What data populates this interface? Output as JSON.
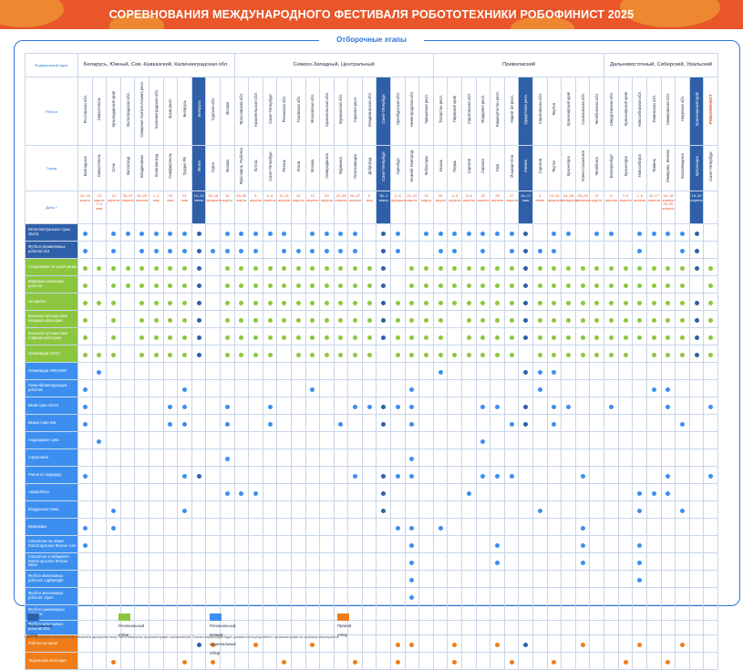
{
  "title": "СОРЕВНОВАНИЯ МЕЖДУНАРОДНОГО ФЕСТИВАЛЯ РОБОТОТЕХНИКИ РОБОФИНИСТ 2025",
  "section_label": "Отборочные этапы",
  "row_labels": {
    "district": "Федеральный округ",
    "region": "Регион",
    "city": "Город",
    "date": "Даты *"
  },
  "logo_text": "РОБОФИНИСТ",
  "colors": {
    "dark": "#2f5fa8",
    "blue": "#3c8ff0",
    "green": "#8cc63f",
    "orange": "#f07d1a",
    "banner": "#e8562a"
  },
  "districts": [
    {
      "name": "Беларусь, Южный, Сев.-Кавказский, Калининградская обл.",
      "span": 11
    },
    {
      "name": "Северо-Западный, Центральный",
      "span": 14
    },
    {
      "name": "Приволжский",
      "span": 12
    },
    {
      "name": "Дальневосточный, Сибирский, Уральский",
      "span": 10
    }
  ],
  "stages": [
    {
      "region": "Ростовская обл.",
      "city": "Волгодонск",
      "date": "14–16\nмарта",
      "hl": false
    },
    {
      "region": "Севастополь",
      "city": "Севастополь",
      "date": "15\nмарта\n2–5\nмая",
      "hl": false
    },
    {
      "region": "Краснодарский край",
      "city": "Сочи",
      "date": "13\nапреля",
      "hl": false
    },
    {
      "region": "Волгоградская обл.",
      "city": "Волгоград",
      "date": "26–27\nапреля",
      "hl": false
    },
    {
      "region": "Северная Осетия-Алания респ.",
      "city": "Владикавказ",
      "date": "26–29\nапреля",
      "hl": false
    },
    {
      "region": "Калининградская обл.",
      "city": "Калининград",
      "date": "1–2\nмая",
      "hl": false
    },
    {
      "region": "Крым респ.",
      "city": "Симферополь",
      "date": "16\nмая",
      "hl": false
    },
    {
      "region": "Беларусь",
      "city": "Гродно РБ",
      "date": "31\nмая",
      "hl": false
    },
    {
      "region": "Беларусь",
      "city": "Минск",
      "date": "12–14\nиюня",
      "hl": true
    },
    {
      "region": "Курская обл.",
      "city": "Курск",
      "date": "15–16\nфевраля",
      "hl": false
    },
    {
      "region": "Москва",
      "city": "Москва",
      "date": "15\nмарта",
      "hl": false
    },
    {
      "region": "Ярославская обл.",
      "city": "Ярославль, Рыбинск",
      "date": "29–30\nмарта",
      "hl": false
    },
    {
      "region": "Архангельская обл.",
      "city": "Котлас",
      "date": "5\nапреля",
      "hl": false
    },
    {
      "region": "Санкт-Петербург",
      "city": "Санкт-Петербург",
      "date": "5–6\nапреля",
      "hl": false
    },
    {
      "region": "Рязанская обл.",
      "city": "Рязань",
      "date": "10–11\nапреля",
      "hl": false
    },
    {
      "region": "Псковская обл.",
      "city": "Псков",
      "date": "12\nапреля",
      "hl": false
    },
    {
      "region": "Московская обл.",
      "city": "Москва",
      "date": "12\nапреля",
      "hl": false
    },
    {
      "region": "Архангельская обл.",
      "city": "Северодвинск",
      "date": "20\nапреля",
      "hl": false
    },
    {
      "region": "Мурманская обл.",
      "city": "Мурманск",
      "date": "25–28\nапреля",
      "hl": false
    },
    {
      "region": "Карелия респ.",
      "city": "Петрозаводск",
      "date": "26–27\nапреля",
      "hl": false
    },
    {
      "region": "Владимирская обл.",
      "city": "Добрград",
      "date": "6\nмая",
      "hl": false
    },
    {
      "region": "Санкт-Петербург",
      "city": "Санкт-Петербург",
      "date": "30–1\nиюня",
      "hl": true
    },
    {
      "region": "Оренбургская обл.",
      "city": "Оренбург",
      "date": "2–5\nфевраля",
      "hl": false
    },
    {
      "region": "Нижегородская обл.",
      "city": "Нижний Новгород",
      "date": "21–22\nмарта",
      "hl": false
    },
    {
      "region": "Чувашская респ.",
      "city": "Чебоксары",
      "date": "23\nмарта",
      "hl": false
    },
    {
      "region": "Татарстан респ.",
      "city": "Казань",
      "date": "30\nмарта",
      "hl": false
    },
    {
      "region": "Пермский край",
      "city": "Пермь",
      "date": "4–5\nапреля",
      "hl": false
    },
    {
      "region": "Саратовская обл.",
      "city": "Саратов",
      "date": "5–6\nапреля",
      "hl": false
    },
    {
      "region": "Мордовия респ.",
      "city": "Саранск",
      "date": "22\nапреля",
      "hl": false
    },
    {
      "region": "Башкортостан респ.",
      "city": "Уфа",
      "date": "25\nапреля",
      "hl": false
    },
    {
      "region": "Марий Эл респ.",
      "city": "Йошкар-Ола",
      "date": "27\nапреля",
      "hl": false
    },
    {
      "region": "Удмуртская респ.",
      "city": "Ижевск",
      "date": "16–17\nмая",
      "hl": true
    },
    {
      "region": "Саратовская обл.",
      "city": "Саратов",
      "date": "2\nиюня",
      "hl": false
    },
    {
      "region": "Якутия",
      "city": "Якутск",
      "date": "14–15\nфевраля",
      "hl": false
    },
    {
      "region": "Красноярский край",
      "city": "Красноярск",
      "date": "24–28\nфевраля",
      "hl": false
    },
    {
      "region": "Сахалинская обл.",
      "city": "Южно-Сахалинск",
      "date": "25–26\nфевраля",
      "hl": false
    },
    {
      "region": "Челябинская обл.",
      "city": "Челябинск",
      "date": "27\nмарта",
      "hl": false
    },
    {
      "region": "Свердловская обл.",
      "city": "Екатеринбург",
      "date": "6\nапреля",
      "hl": false
    },
    {
      "region": "Красноярский край",
      "city": "Красноярск",
      "date": "7–9\nапреля",
      "hl": false
    },
    {
      "region": "Новосибирская обл.",
      "city": "Новосибирск",
      "date": "7–9\nапреля",
      "hl": false
    },
    {
      "region": "Тюменская обл.",
      "city": "Тюмень",
      "date": "16–17\nапреля",
      "hl": false
    },
    {
      "region": "Кемеровская обл.",
      "city": "Кемерово, Белово",
      "date": "18–19\nапреля\n25–26\nапреля",
      "hl": false
    },
    {
      "region": "Амурская обл.",
      "city": "Благовещенск",
      "date": "",
      "hl": false
    },
    {
      "region": "Красноярский край",
      "city": "Красноярск",
      "date": "19–20\nапреля",
      "hl": true
    },
    {
      "region": "",
      "city": "Санкт-Петербург",
      "date": "",
      "hl": false,
      "logo": true
    }
  ],
  "disciplines": [
    {
      "name": "Интеллектуальное сумо 15х15",
      "color": "#2f5fa8",
      "dot": "#3c8ff0",
      "marks": "10111111101111101111011011111111011011011111010"
    },
    {
      "name": "Футбол управляемых роботов 3х3",
      "color": "#2f5fa8",
      "dot": "#3c8ff0",
      "marks": "10101111111110111111011001101011110000010011000"
    },
    {
      "name": "Следование по узкой линии",
      "color": "#8cc63f",
      "dot": "#8cc63f",
      "marks": "11111111101111111111110111111111111111111111110"
    },
    {
      "name": "Марафон шагающих роботов",
      "color": "#8cc63f",
      "dot": "#8cc63f",
      "marks": "10111111101111111111110111111111111111111110110"
    },
    {
      "name": "Эстафета",
      "color": "#8cc63f",
      "dot": "#8cc63f",
      "marks": "11101111101111111111111111111111111111111111111"
    },
    {
      "name": "Большое путешествие младшая категория",
      "color": "#8cc63f",
      "dot": "#8cc63f",
      "marks": "10101111101111111111111111011111111111111111111"
    },
    {
      "name": "Большое путешествие старшая категория",
      "color": "#8cc63f",
      "dot": "#8cc63f",
      "marks": "10101111101111111111111111011111111111111111111"
    },
    {
      "name": "Олимпиада LEGO",
      "color": "#8cc63f",
      "dot": "#8cc63f",
      "marks": "11101111101111011111101111111110111111101111110"
    },
    {
      "name": "Олимпиада ARDUINO",
      "color": "#3c8ff0",
      "dot": "#3c8ff0",
      "marks": "01000000000000000000000001000001110000000000010"
    },
    {
      "name": "Гонки балансирующих роботов",
      "color": "#3c8ff0",
      "dot": "#3c8ff0",
      "marks": "10000001000000001000000100000000100000001100010"
    },
    {
      "name": "Мини-сумо 10х10",
      "color": "#3c8ff0",
      "dot": "#3c8ff0",
      "marks": "10000011001001000001111100001101011001000100100"
    },
    {
      "name": "Микро-сумо 5х5",
      "color": "#3c8ff0",
      "dot": "#3c8ff0",
      "marks": "10000011001001000010010100000011010000000010000"
    },
    {
      "name": "Андроидное сумо",
      "color": "#3c8ff0",
      "dot": "#3c8ff0",
      "marks": "01000000000000000000000000001000000000000000000"
    },
    {
      "name": "Аэрохоккей",
      "color": "#3c8ff0",
      "dot": "#3c8ff0",
      "marks": "00000000001000000000000100000000000000000000011"
    },
    {
      "name": "Ралли по коридору",
      "color": "#3c8ff0",
      "dot": "#3c8ff0",
      "marks": "10000001100000000001011100001110000100000100100"
    },
    {
      "name": "Аквароботы",
      "color": "#3c8ff0",
      "dot": "#3c8ff0",
      "marks": "00000000001110000000010000010000000000011100010"
    },
    {
      "name": "Воздушные гонки",
      "color": "#3c8ff0",
      "dot": "#3c8ff0",
      "marks": "00100001000000000000010000000000100000010010010"
    },
    {
      "name": "Микроквиз",
      "color": "#3c8ff0",
      "dot": "#3c8ff0",
      "marks": "10100000000000000000001101000000000100000000000"
    },
    {
      "name": "Спасатели на линии RoboCupJunior Rescue Line",
      "color": "#3c8ff0",
      "dot": "#3c8ff0",
      "marks": "10000000000000000000000100000100000100010000010"
    },
    {
      "name": "Спасатели в лабиринте RoboCupJunior Rescue Maze",
      "color": "#3c8ff0",
      "dot": "#3c8ff0",
      "marks": "00000000000000000000000100000100000100010000010"
    },
    {
      "name": "Футбол автономных роботов: Lightweight",
      "color": "#3c8ff0",
      "dot": "#3c8ff0",
      "marks": "00000000000000000000000100000000000000010000000"
    },
    {
      "name": "Футбол автономных роботов: Open",
      "color": "#3c8ff0",
      "dot": "#3c8ff0",
      "marks": "00000000000000000000000100000000000000000000000"
    },
    {
      "name": "Футбол гуманоидных роботов",
      "color": "#3c8ff0",
      "dot": "#3c8ff0",
      "marks": "00000000000000000000000000000000000000000000000"
    },
    {
      "name": "Футбол автономных роботов SSL",
      "color": "#3c8ff0",
      "dot": "#3c8ff0",
      "marks": "00000000000000000000000000000000000000000000000"
    },
    {
      "name": "Роботы на сцене",
      "color": "#f07d1a",
      "dot": "#f07d1a",
      "marks": "00000000110010001000001100100101000100010010011"
    },
    {
      "name": "Творческая категория",
      "color": "#f07d1a",
      "dot": "#f07d1a",
      "marks": "00100001010000100001001000100010010000100100011"
    }
  ],
  "legend": [
    {
      "label": "Федеральный отбор",
      "color": "#2f5fa8"
    },
    {
      "label": "Региональный отбор",
      "color": "#8cc63f"
    },
    {
      "label": "Региональный, прямой, национальный отбор",
      "color": "#3c8ff0"
    },
    {
      "label": "Прямой отбор",
      "color": "#f07d1a"
    }
  ],
  "footnote": "* Даты проведения мероприятий и перечень дисциплин могут быть изменены организаторами соревнований. Точная информация будет указана непосредственно организаторами на странице мероприятия."
}
